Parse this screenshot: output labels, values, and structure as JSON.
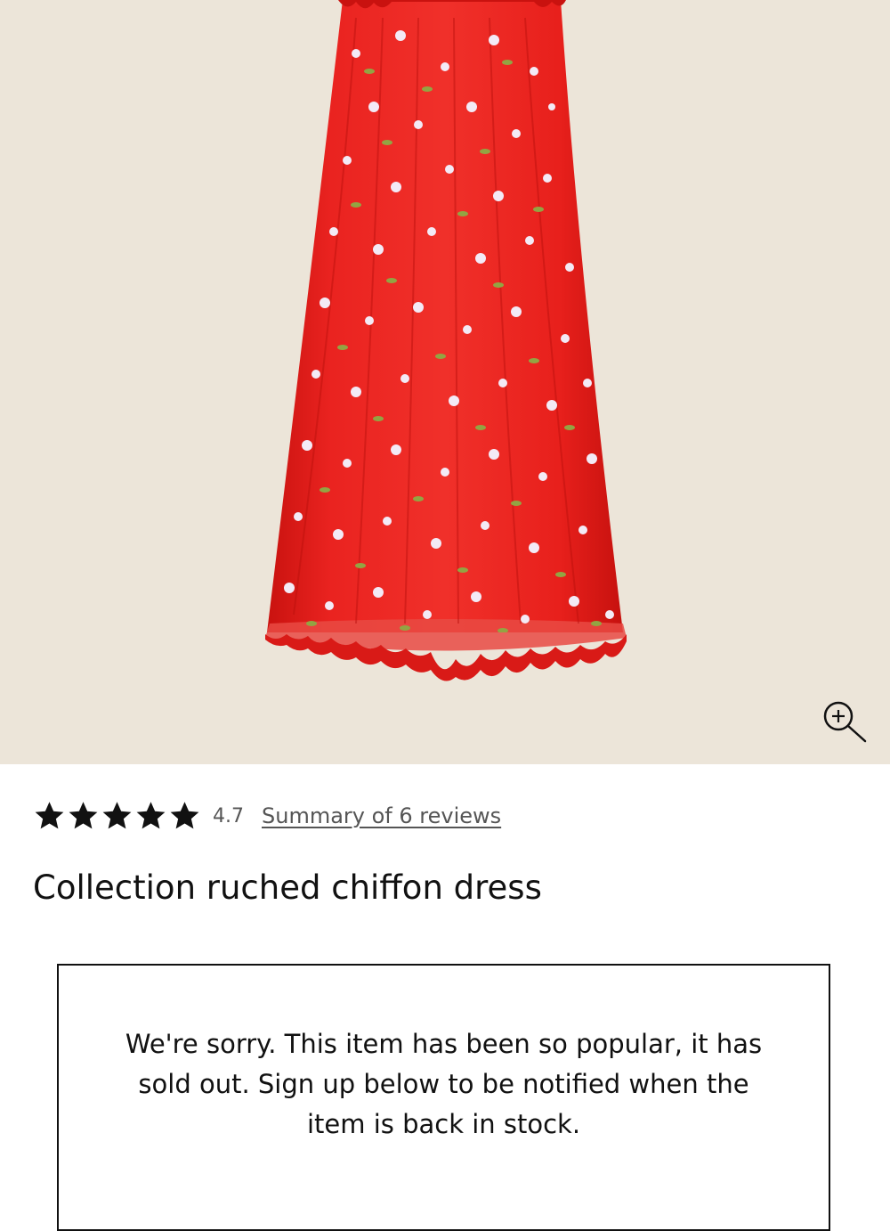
{
  "product": {
    "image_alt": "Collection ruched chiffon dress",
    "title": "Collection ruched chiffon dress",
    "rating": {
      "stars": 5,
      "value": "4.7",
      "reviews_link": "Summary of 6 reviews"
    },
    "zoom_icon": "zoom-in-icon"
  },
  "soldout": {
    "message": "We're sorry. This item has been so popular, it has sold out. Sign up below to be notified when the item is back in stock."
  },
  "colors": {
    "image_background": "#ece5d9",
    "dress_red": "#e8221f",
    "flower_white": "#f3eaf6",
    "leaf_green": "#93a443",
    "text": "#111111",
    "muted_text": "#555555"
  }
}
